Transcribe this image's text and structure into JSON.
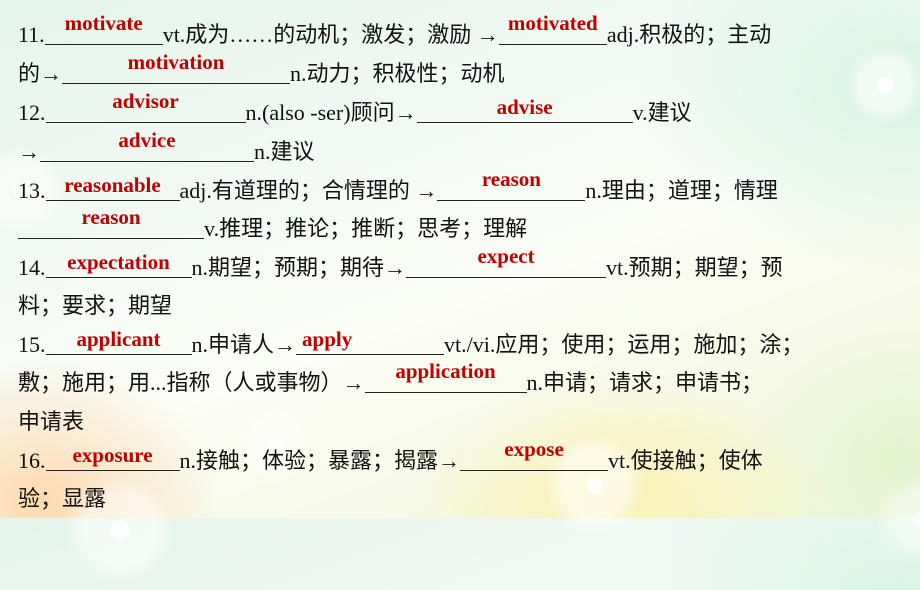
{
  "items": [
    {
      "number": "11.",
      "lines": [
        {
          "parts": [
            {
              "type": "text",
              "value": "11."
            },
            {
              "type": "blank",
              "answer": "motivate"
            },
            {
              "type": "text",
              "value": "vt.成为……的动机；激发；激励 →"
            },
            {
              "type": "blank",
              "answer": "motivated"
            },
            {
              "type": "text",
              "value": "adj.积极的；主动"
            }
          ]
        },
        {
          "parts": [
            {
              "type": "text",
              "value": "的→"
            },
            {
              "type": "blank",
              "answer": "motivation"
            },
            {
              "type": "text",
              "value": "n.动力；积极性；动机"
            }
          ]
        }
      ]
    },
    {
      "number": "12.",
      "lines": [
        {
          "parts": [
            {
              "type": "text",
              "value": "12."
            },
            {
              "type": "blank",
              "answer": "advisor"
            },
            {
              "type": "text",
              "value": "n.(also -ser)顾问→"
            },
            {
              "type": "blank",
              "answer": "advise"
            },
            {
              "type": "text",
              "value": "v.建议"
            }
          ]
        },
        {
          "parts": [
            {
              "type": "text",
              "value": "→"
            },
            {
              "type": "blank",
              "answer": "advice"
            },
            {
              "type": "text",
              "value": "n.建议"
            }
          ]
        }
      ]
    },
    {
      "number": "13.",
      "lines": [
        {
          "parts": [
            {
              "type": "text",
              "value": "13."
            },
            {
              "type": "blank",
              "answer": "reasonable"
            },
            {
              "type": "text",
              "value": "adj.有道理的；合情理的 →"
            },
            {
              "type": "blank",
              "answer": "reason"
            },
            {
              "type": "text",
              "value": "n.理由；道理；情理"
            }
          ]
        },
        {
          "parts": [
            {
              "type": "blank",
              "answer": "reason"
            },
            {
              "type": "text",
              "value": " v.推理；推论；推断；思考；理解"
            }
          ]
        }
      ]
    },
    {
      "number": "14.",
      "lines": [
        {
          "parts": [
            {
              "type": "text",
              "value": "14."
            },
            {
              "type": "blank",
              "answer": "expectation"
            },
            {
              "type": "text",
              "value": " n.期望；预期；期待→"
            },
            {
              "type": "blank",
              "answer": "expect"
            },
            {
              "type": "text",
              "value": " vt.预期；期望；预"
            }
          ]
        },
        {
          "parts": [
            {
              "type": "text",
              "value": "料；要求；期望"
            }
          ]
        }
      ]
    },
    {
      "number": "15.",
      "lines": [
        {
          "parts": [
            {
              "type": "text",
              "value": "15."
            },
            {
              "type": "blank",
              "answer": "applicant"
            },
            {
              "type": "text",
              "value": " n.申请人→"
            },
            {
              "type": "blank",
              "answer": "apply"
            },
            {
              "type": "text",
              "value": "vt./vi.应用；使用；运用；施加；涂；"
            }
          ]
        },
        {
          "parts": [
            {
              "type": "text",
              "value": "敷；施用；用...指称（人或事物）→"
            },
            {
              "type": "blank",
              "answer": "application"
            },
            {
              "type": "text",
              "value": "n.申请；请求；申请书；"
            }
          ]
        },
        {
          "parts": [
            {
              "type": "text",
              "value": "申请表"
            }
          ]
        }
      ]
    },
    {
      "number": "16.",
      "lines": [
        {
          "parts": [
            {
              "type": "text",
              "value": "16. "
            },
            {
              "type": "blank",
              "answer": "exposure"
            },
            {
              "type": "text",
              "value": " n.接触；体验；暴露；揭露→"
            },
            {
              "type": "blank",
              "answer": "expose"
            },
            {
              "type": "text",
              "value": " vt.使接触；使体"
            }
          ]
        },
        {
          "parts": [
            {
              "type": "text",
              "value": "验；显露"
            }
          ]
        }
      ]
    }
  ],
  "colors": {
    "answer": "#c00000",
    "text": "#111111"
  }
}
